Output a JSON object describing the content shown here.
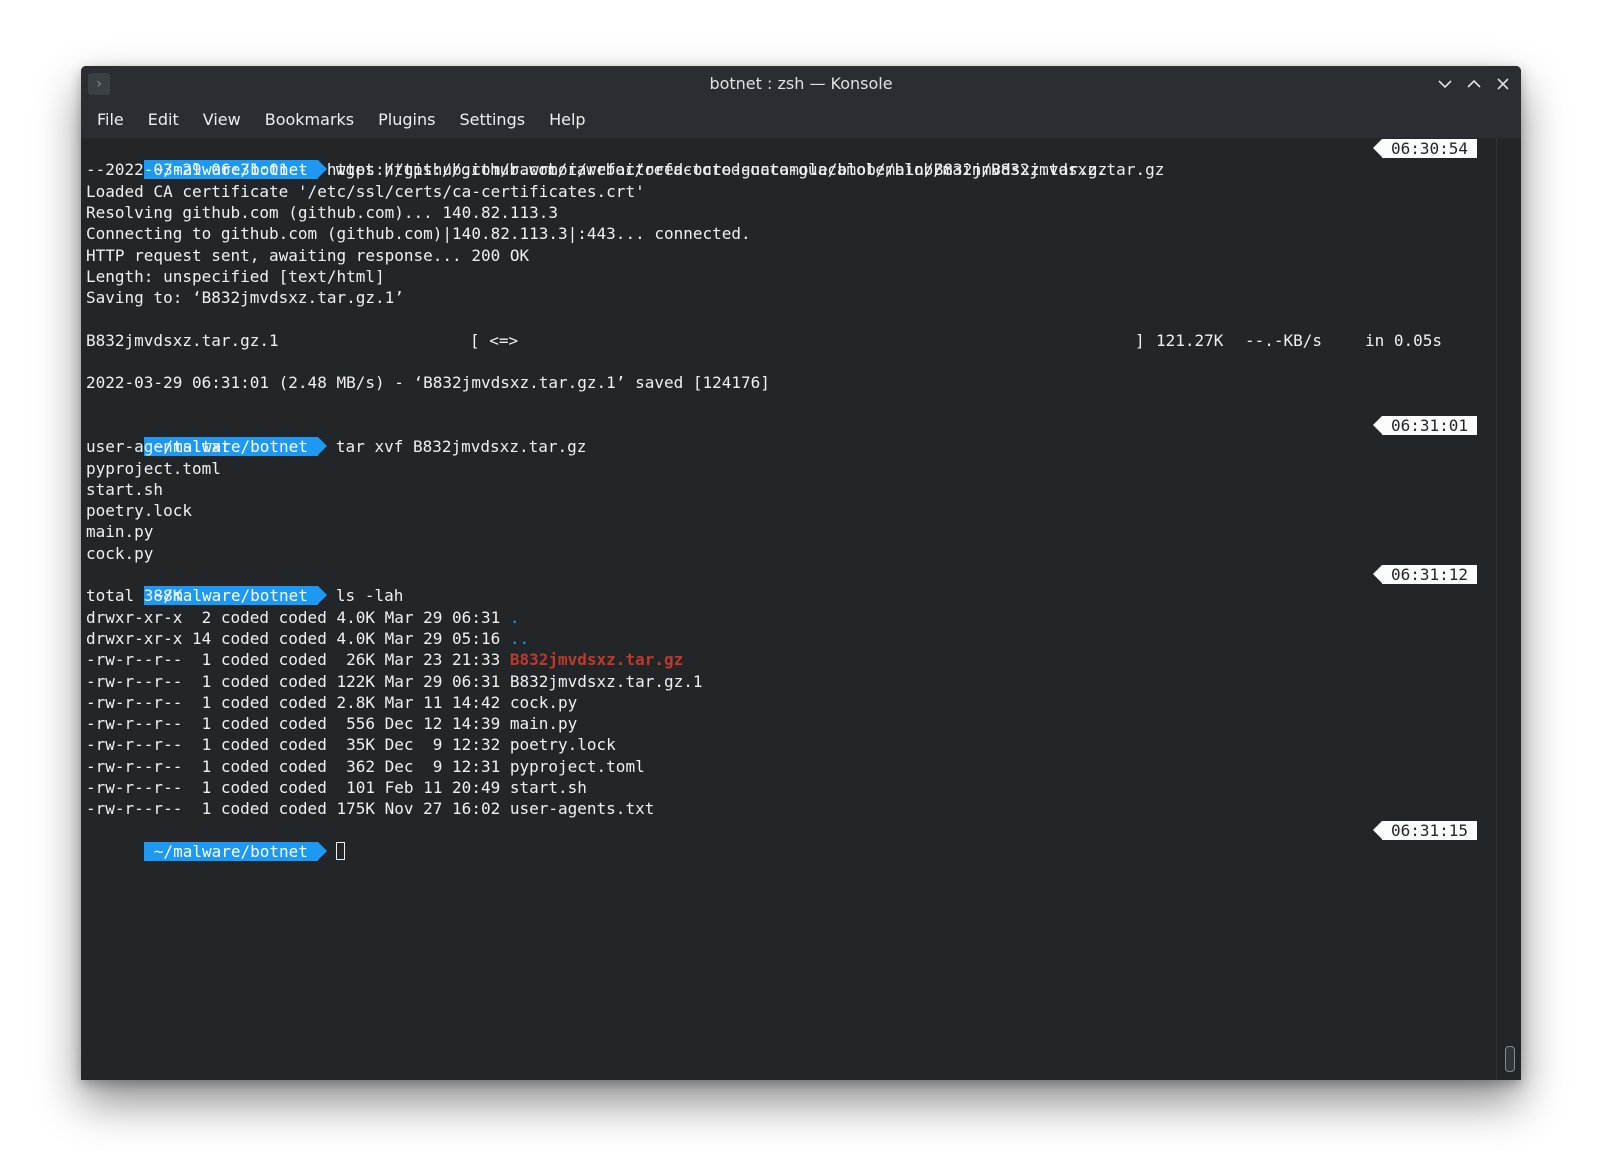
{
  "window": {
    "title": "botnet : zsh — Konsole",
    "app_icon_glyph": "›",
    "controls": [
      "minimize-icon",
      "maximize-icon",
      "close-icon"
    ]
  },
  "menu": [
    "File",
    "Edit",
    "View",
    "Bookmarks",
    "Plugins",
    "Settings",
    "Help"
  ],
  "prompt_path": "~/malware/botnet",
  "blocks": {
    "wget": {
      "command": "wget https://github.com/rawrboi/refactored-octo-guacamole/blob/main/B832jmvdsxz.tar.gz",
      "time": "06:30:54",
      "out1": "--2022-03-29 06:31:01--  https://github.com/rawrboi/refactored-octo-guacamole/blob/main/B832jmvdsxz.tar.gz",
      "out2": "Loaded CA certificate '/etc/ssl/certs/ca-certificates.crt'",
      "out3": "Resolving github.com (github.com)... 140.82.113.3",
      "out4": "Connecting to github.com (github.com)|140.82.113.3|:443... connected.",
      "out5": "HTTP request sent, awaiting response... 200 OK",
      "out6": "Length: unspecified [text/html]",
      "out7": "Saving to: ‘B832jmvdsxz.tar.gz.1’",
      "progress_file": "B832jmvdsxz.tar.gz.1",
      "progress_bar_open": "[ <=>",
      "progress_bar_close": "]",
      "progress_size": "121.27K",
      "progress_rate": "--.-KB/s",
      "progress_time": "in 0.05s",
      "saved": "2022-03-29 06:31:01 (2.48 MB/s) - ‘B832jmvdsxz.tar.gz.1’ saved [124176]"
    },
    "tar": {
      "command": "tar xvf B832jmvdsxz.tar.gz",
      "time": "06:31:01",
      "files": [
        "user-agents.txt",
        "pyproject.toml",
        "start.sh",
        "poetry.lock",
        "main.py",
        "cock.py"
      ]
    },
    "ls": {
      "command": "ls -lah",
      "time": "06:31:12",
      "total": "total 388K",
      "rows": [
        {
          "meta": "drwxr-xr-x  2 coded coded 4.0K Mar 29 06:31 ",
          "name": "."
        },
        {
          "meta": "drwxr-xr-x 14 coded coded 4.0K Mar 29 05:16 ",
          "name": ".."
        },
        {
          "meta": "-rw-r--r--  1 coded coded  26K Mar 23 21:33 ",
          "name": "B832jmvdsxz.tar.gz"
        },
        {
          "meta": "-rw-r--r--  1 coded coded 122K Mar 29 06:31 ",
          "name": "B832jmvdsxz.tar.gz.1"
        },
        {
          "meta": "-rw-r--r--  1 coded coded 2.8K Mar 11 14:42 ",
          "name": "cock.py"
        },
        {
          "meta": "-rw-r--r--  1 coded coded  556 Dec 12 14:39 ",
          "name": "main.py"
        },
        {
          "meta": "-rw-r--r--  1 coded coded  35K Dec  9 12:32 ",
          "name": "poetry.lock"
        },
        {
          "meta": "-rw-r--r--  1 coded coded  362 Dec  9 12:31 ",
          "name": "pyproject.toml"
        },
        {
          "meta": "-rw-r--r--  1 coded coded  101 Feb 11 20:49 ",
          "name": "start.sh"
        },
        {
          "meta": "-rw-r--r--  1 coded coded 175K Nov 27 16:02 ",
          "name": "user-agents.txt"
        }
      ]
    },
    "current": {
      "time": "06:31:15"
    }
  },
  "colors": {
    "prompt_bg": "#1d99f3",
    "terminal_bg": "#232629",
    "archive_file": "#c0392b",
    "directory": "#1d99f3"
  }
}
